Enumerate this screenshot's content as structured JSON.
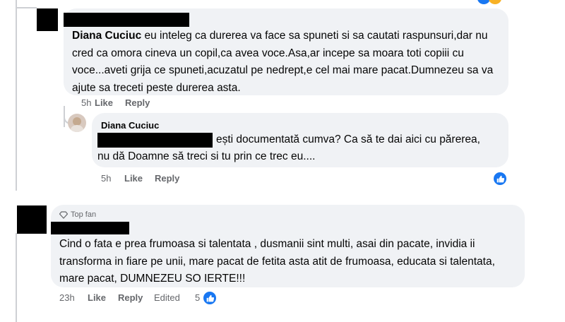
{
  "comment1": {
    "author": "Diana Cuciuc",
    "text": " eu inteleg ca durerea va face sa spuneti si sa cautati raspunsuri,dar nu cred ca omora cineva un copil,ca avea voce.Asa,ar incepe sa moara toti copiii cu voce...aveti grija ce spuneti,acuzatul pe nedrept,e cel mai mare pacat.Dumnezeu sa va ajute sa treceti peste durerea asta.",
    "time": "5h",
    "like": "Like",
    "reply": "Reply"
  },
  "reply1": {
    "author": "Diana Cuciuc",
    "line1": "ești documentată cumva? Ca să te dai aici cu părerea,",
    "line2": "nu dă Doamne să treci si tu prin ce trec eu....",
    "time": "5h",
    "like": "Like",
    "reply": "Reply"
  },
  "comment2": {
    "badge": "Top fan",
    "text": "Cind o fata e prea frumoasa si talentata , dusmanii sint multi, asai din pacate, invidia ii transforma in fiare pe unii, mare pacat de fetita asta atit de frumoasa, educata si talentata, mare pacat, DUMNEZEU SO IERTE!!!",
    "time": "23h",
    "like": "Like",
    "reply": "Reply",
    "edited": "Edited",
    "reaction_count": "5"
  },
  "colors": {
    "bubble": "#f0f2f5",
    "meta": "#65676b",
    "like_blue": "#1877f2",
    "thread": "#ced0d4"
  },
  "icons": {
    "like": "like-icon",
    "top_fan": "diamond-icon",
    "avatar": "avatar"
  }
}
